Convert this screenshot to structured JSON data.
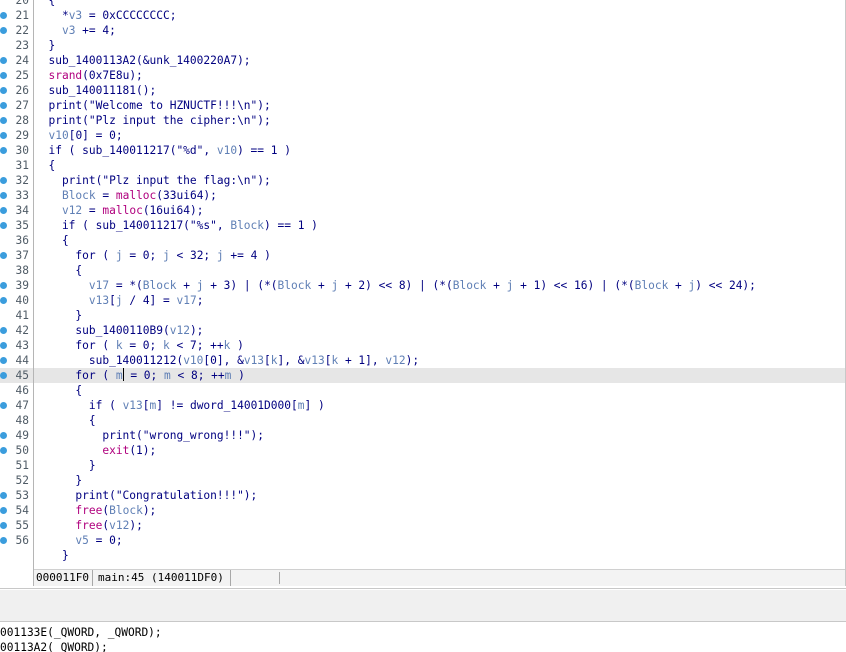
{
  "code_lines": [
    {
      "num": "20",
      "bp": false,
      "hl": false,
      "tokens": [
        {
          "t": "  {"
        }
      ]
    },
    {
      "num": "21",
      "bp": true,
      "hl": false,
      "tokens": [
        {
          "t": "    *"
        },
        {
          "t": "v3",
          "c": "v"
        },
        {
          "t": " = 0xCCCCCCCC;"
        }
      ]
    },
    {
      "num": "22",
      "bp": true,
      "hl": false,
      "tokens": [
        {
          "t": "    "
        },
        {
          "t": "v3",
          "c": "v"
        },
        {
          "t": " += 4;"
        }
      ]
    },
    {
      "num": "23",
      "bp": false,
      "hl": false,
      "tokens": [
        {
          "t": "  }"
        }
      ]
    },
    {
      "num": "24",
      "bp": true,
      "hl": false,
      "tokens": [
        {
          "t": "  sub_1400113A2(&unk_1400220A7);"
        }
      ]
    },
    {
      "num": "25",
      "bp": true,
      "hl": false,
      "tokens": [
        {
          "t": "  "
        },
        {
          "t": "srand",
          "c": "f"
        },
        {
          "t": "(0x7E8u);"
        }
      ]
    },
    {
      "num": "26",
      "bp": true,
      "hl": false,
      "tokens": [
        {
          "t": "  sub_140011181();"
        }
      ]
    },
    {
      "num": "27",
      "bp": true,
      "hl": false,
      "tokens": [
        {
          "t": "  print(\"Welcome to HZNUCTF!!!\\n\");"
        }
      ]
    },
    {
      "num": "28",
      "bp": true,
      "hl": false,
      "tokens": [
        {
          "t": "  print(\"Plz input the cipher:\\n\");"
        }
      ]
    },
    {
      "num": "29",
      "bp": true,
      "hl": false,
      "tokens": [
        {
          "t": "  "
        },
        {
          "t": "v10",
          "c": "v"
        },
        {
          "t": "[0] = 0;"
        }
      ]
    },
    {
      "num": "30",
      "bp": true,
      "hl": false,
      "tokens": [
        {
          "t": "  if ( sub_140011217(\"%d\", "
        },
        {
          "t": "v10",
          "c": "v"
        },
        {
          "t": ") == 1 )"
        }
      ]
    },
    {
      "num": "31",
      "bp": false,
      "hl": false,
      "tokens": [
        {
          "t": "  {"
        }
      ]
    },
    {
      "num": "32",
      "bp": true,
      "hl": false,
      "tokens": [
        {
          "t": "    print(\"Plz input the flag:\\n\");"
        }
      ]
    },
    {
      "num": "33",
      "bp": true,
      "hl": false,
      "tokens": [
        {
          "t": "    "
        },
        {
          "t": "Block",
          "c": "v"
        },
        {
          "t": " = "
        },
        {
          "t": "malloc",
          "c": "f"
        },
        {
          "t": "(33ui64);"
        }
      ]
    },
    {
      "num": "34",
      "bp": true,
      "hl": false,
      "tokens": [
        {
          "t": "    "
        },
        {
          "t": "v12",
          "c": "v"
        },
        {
          "t": " = "
        },
        {
          "t": "malloc",
          "c": "f"
        },
        {
          "t": "(16ui64);"
        }
      ]
    },
    {
      "num": "35",
      "bp": true,
      "hl": false,
      "tokens": [
        {
          "t": "    if ( sub_140011217(\"%s\", "
        },
        {
          "t": "Block",
          "c": "v"
        },
        {
          "t": ") == 1 )"
        }
      ]
    },
    {
      "num": "36",
      "bp": false,
      "hl": false,
      "tokens": [
        {
          "t": "    {"
        }
      ]
    },
    {
      "num": "37",
      "bp": true,
      "hl": false,
      "tokens": [
        {
          "t": "      for ( "
        },
        {
          "t": "j",
          "c": "v"
        },
        {
          "t": " = 0; "
        },
        {
          "t": "j",
          "c": "v"
        },
        {
          "t": " < 32; "
        },
        {
          "t": "j",
          "c": "v"
        },
        {
          "t": " += 4 )"
        }
      ]
    },
    {
      "num": "38",
      "bp": false,
      "hl": false,
      "tokens": [
        {
          "t": "      {"
        }
      ]
    },
    {
      "num": "39",
      "bp": true,
      "hl": false,
      "tokens": [
        {
          "t": "        "
        },
        {
          "t": "v17",
          "c": "v"
        },
        {
          "t": " = *("
        },
        {
          "t": "Block",
          "c": "v"
        },
        {
          "t": " + "
        },
        {
          "t": "j",
          "c": "v"
        },
        {
          "t": " + 3) | (*("
        },
        {
          "t": "Block",
          "c": "v"
        },
        {
          "t": " + "
        },
        {
          "t": "j",
          "c": "v"
        },
        {
          "t": " + 2) << 8) | (*("
        },
        {
          "t": "Block",
          "c": "v"
        },
        {
          "t": " + "
        },
        {
          "t": "j",
          "c": "v"
        },
        {
          "t": " + 1) << 16) | (*("
        },
        {
          "t": "Block",
          "c": "v"
        },
        {
          "t": " + "
        },
        {
          "t": "j",
          "c": "v"
        },
        {
          "t": ") << 24);"
        }
      ]
    },
    {
      "num": "40",
      "bp": true,
      "hl": false,
      "tokens": [
        {
          "t": "        "
        },
        {
          "t": "v13",
          "c": "v"
        },
        {
          "t": "["
        },
        {
          "t": "j",
          "c": "v"
        },
        {
          "t": " / 4] = "
        },
        {
          "t": "v17",
          "c": "v"
        },
        {
          "t": ";"
        }
      ]
    },
    {
      "num": "41",
      "bp": false,
      "hl": false,
      "tokens": [
        {
          "t": "      }"
        }
      ]
    },
    {
      "num": "42",
      "bp": true,
      "hl": false,
      "tokens": [
        {
          "t": "      sub_1400110B9("
        },
        {
          "t": "v12",
          "c": "v"
        },
        {
          "t": ");"
        }
      ]
    },
    {
      "num": "43",
      "bp": true,
      "hl": false,
      "tokens": [
        {
          "t": "      for ( "
        },
        {
          "t": "k",
          "c": "v"
        },
        {
          "t": " = 0; "
        },
        {
          "t": "k",
          "c": "v"
        },
        {
          "t": " < 7; ++"
        },
        {
          "t": "k",
          "c": "v"
        },
        {
          "t": " )"
        }
      ]
    },
    {
      "num": "44",
      "bp": true,
      "hl": false,
      "tokens": [
        {
          "t": "        sub_140011212("
        },
        {
          "t": "v10",
          "c": "v"
        },
        {
          "t": "[0], &"
        },
        {
          "t": "v13",
          "c": "v"
        },
        {
          "t": "["
        },
        {
          "t": "k",
          "c": "v"
        },
        {
          "t": "], &"
        },
        {
          "t": "v13",
          "c": "v"
        },
        {
          "t": "["
        },
        {
          "t": "k",
          "c": "v"
        },
        {
          "t": " + 1], "
        },
        {
          "t": "v12",
          "c": "v"
        },
        {
          "t": ");"
        }
      ]
    },
    {
      "num": "45",
      "bp": true,
      "hl": true,
      "tokens": [
        {
          "t": "      for ( "
        },
        {
          "t": "m",
          "c": "v"
        },
        {
          "t": " ",
          "caret": true
        },
        {
          "t": "= 0; "
        },
        {
          "t": "m",
          "c": "v"
        },
        {
          "t": " < 8; ++"
        },
        {
          "t": "m",
          "c": "v"
        },
        {
          "t": " )"
        }
      ]
    },
    {
      "num": "46",
      "bp": false,
      "hl": false,
      "tokens": [
        {
          "t": "      {"
        }
      ]
    },
    {
      "num": "47",
      "bp": true,
      "hl": false,
      "tokens": [
        {
          "t": "        if ( "
        },
        {
          "t": "v13",
          "c": "v"
        },
        {
          "t": "["
        },
        {
          "t": "m",
          "c": "v"
        },
        {
          "t": "] != dword_14001D000["
        },
        {
          "t": "m",
          "c": "v"
        },
        {
          "t": "] )"
        }
      ]
    },
    {
      "num": "48",
      "bp": false,
      "hl": false,
      "tokens": [
        {
          "t": "        {"
        }
      ]
    },
    {
      "num": "49",
      "bp": true,
      "hl": false,
      "tokens": [
        {
          "t": "          print(\"wrong_wrong!!!\");"
        }
      ]
    },
    {
      "num": "50",
      "bp": true,
      "hl": false,
      "tokens": [
        {
          "t": "          "
        },
        {
          "t": "exit",
          "c": "f"
        },
        {
          "t": "(1);"
        }
      ]
    },
    {
      "num": "51",
      "bp": false,
      "hl": false,
      "tokens": [
        {
          "t": "        }"
        }
      ]
    },
    {
      "num": "52",
      "bp": false,
      "hl": false,
      "tokens": [
        {
          "t": "      }"
        }
      ]
    },
    {
      "num": "53",
      "bp": true,
      "hl": false,
      "tokens": [
        {
          "t": "      print(\"Congratulation!!!\");"
        }
      ]
    },
    {
      "num": "54",
      "bp": true,
      "hl": false,
      "tokens": [
        {
          "t": "      "
        },
        {
          "t": "free",
          "c": "f"
        },
        {
          "t": "("
        },
        {
          "t": "Block",
          "c": "v"
        },
        {
          "t": ");"
        }
      ]
    },
    {
      "num": "55",
      "bp": true,
      "hl": false,
      "tokens": [
        {
          "t": "      "
        },
        {
          "t": "free",
          "c": "f"
        },
        {
          "t": "("
        },
        {
          "t": "v12",
          "c": "v"
        },
        {
          "t": ");"
        }
      ]
    },
    {
      "num": "56",
      "bp": true,
      "hl": false,
      "tokens": [
        {
          "t": "      "
        },
        {
          "t": "v5",
          "c": "v"
        },
        {
          "t": " = 0;"
        }
      ]
    },
    {
      "num": "",
      "bp": false,
      "hl": false,
      "tokens": [
        {
          "t": "    }"
        }
      ]
    }
  ],
  "status": {
    "address": "000011F0",
    "location": "main:45 (140011DF0)"
  },
  "bottom_lines": [
    "001133E(_QWORD, _QWORD);",
    "00113A2(_QWORD);"
  ],
  "colors": {
    "code": "#000080",
    "variable": "#5f7fb5",
    "function": "#b0007e",
    "breakpoint_dot": "#3b9ddd",
    "current_line": "#e6e6e6"
  }
}
